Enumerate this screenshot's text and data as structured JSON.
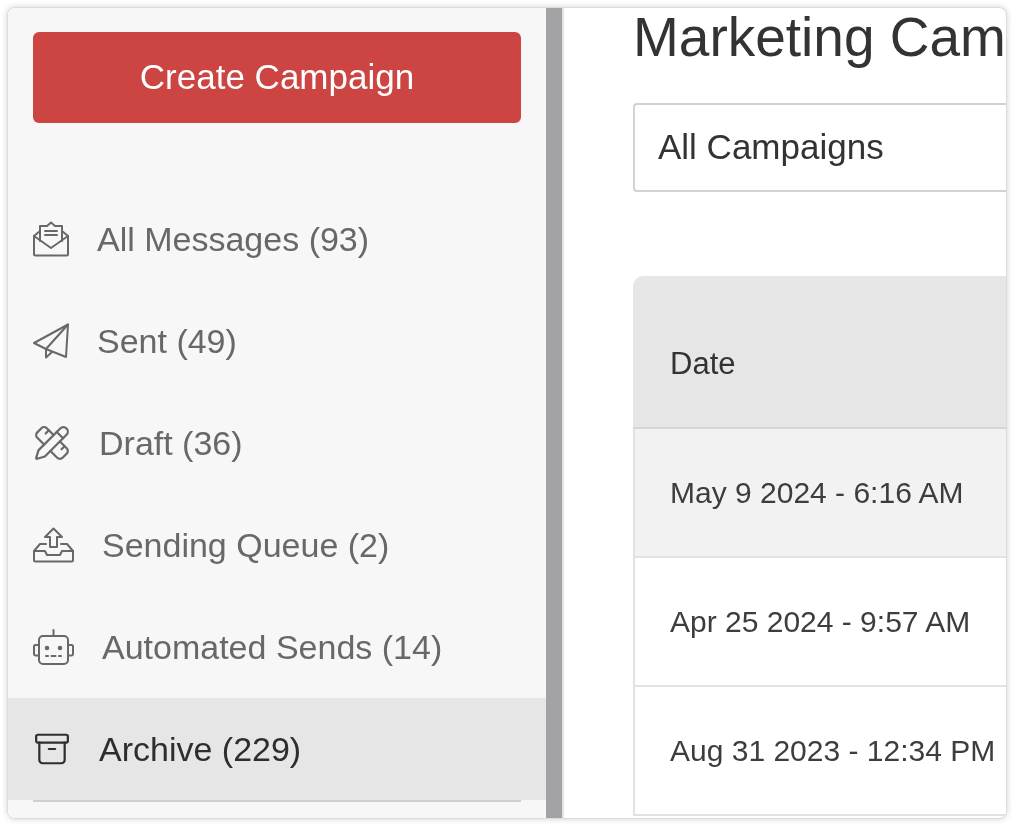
{
  "sidebar": {
    "create_button": {
      "label": "Create Campaign"
    },
    "items": [
      {
        "label": "All Messages (93)",
        "selected": false
      },
      {
        "label": "Sent (49)",
        "selected": false
      },
      {
        "label": "Draft (36)",
        "selected": false
      },
      {
        "label": "Sending Queue (2)",
        "selected": false
      },
      {
        "label": "Automated Sends (14)",
        "selected": false
      },
      {
        "label": "Archive (229)",
        "selected": true
      }
    ]
  },
  "main": {
    "title": "Marketing Cam",
    "filter": {
      "value": "All Campaigns"
    }
  },
  "table": {
    "columns": [
      "Date"
    ],
    "rows": [
      {
        "date": "May 9 2024 - 6:16 AM",
        "highlighted": true
      },
      {
        "date": "Apr 25 2024 - 9:57 AM",
        "highlighted": false
      },
      {
        "date": "Aug 31 2023 - 12:34 PM",
        "highlighted": false
      }
    ]
  }
}
